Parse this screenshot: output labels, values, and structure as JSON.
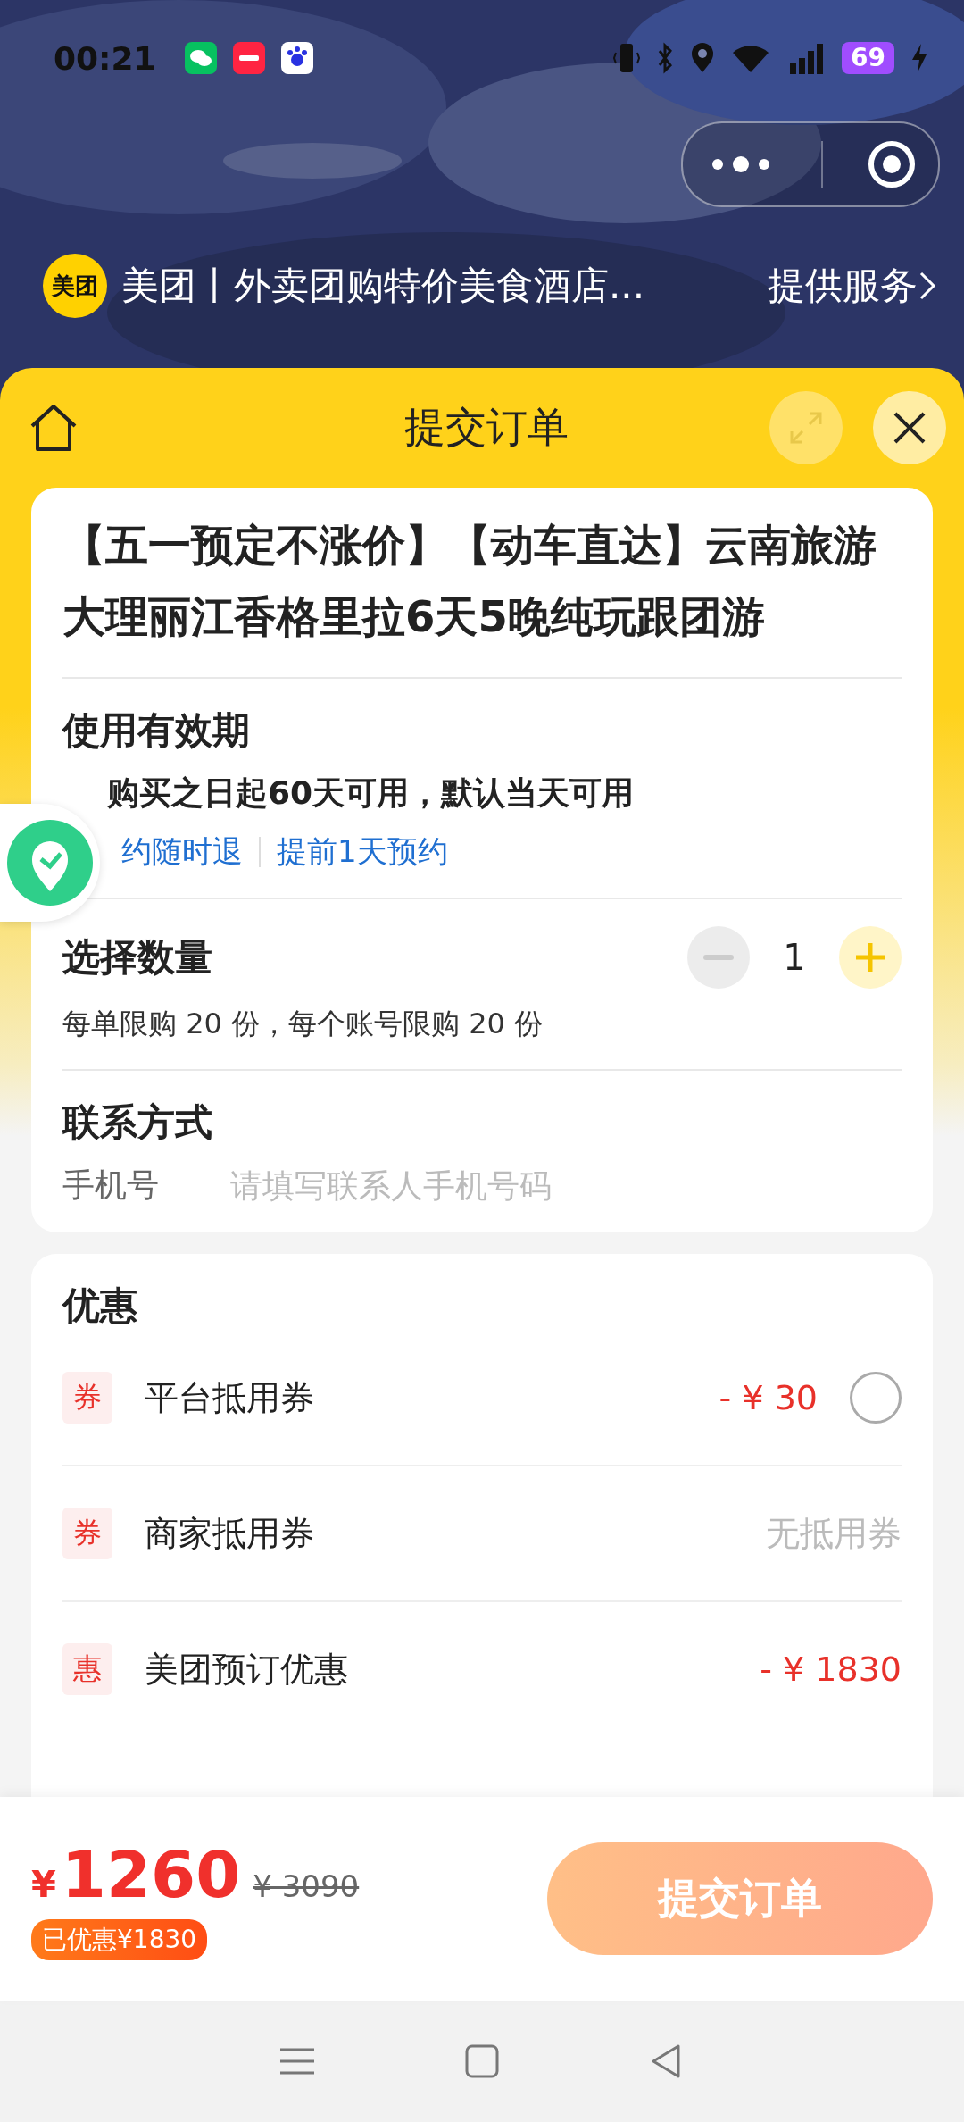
{
  "status_bar": {
    "time": "00:21",
    "battery": "69"
  },
  "mini_program": {
    "logo_text": "美团",
    "name": "美团丨外卖团购特价美食酒店...",
    "service_link": "提供服务"
  },
  "sheet": {
    "title": "提交订单",
    "expand_disabled": true
  },
  "product": {
    "title": "【五一预定不涨价】【动车直达】云南旅游大理丽江香格里拉6天5晚纯玩跟团游"
  },
  "validity": {
    "heading": "使用有效期",
    "text": "购买之日起60天可用，默认当天可用",
    "tags": [
      "约随时退",
      "提前1天预约"
    ]
  },
  "quantity": {
    "heading": "选择数量",
    "value": "1",
    "minus_disabled": true,
    "limit": "每单限购 20 份，每个账号限购 20 份"
  },
  "contact": {
    "heading": "联系方式",
    "label": "手机号",
    "placeholder": "请填写联系人手机号码"
  },
  "discounts": {
    "heading": "优惠",
    "rows": [
      {
        "badge": "券",
        "name": "平台抵用券",
        "value": "- ¥ 30",
        "kind": "radio",
        "checked": false
      },
      {
        "badge": "券",
        "name": "商家抵用券",
        "value": "无抵用券",
        "kind": "unavailable"
      },
      {
        "badge": "惠",
        "name": "美团预订优惠",
        "value": "- ¥ 1830",
        "kind": "amount"
      }
    ]
  },
  "footer": {
    "currency": "¥",
    "price": "1260",
    "original_price": "¥ 3090",
    "saved": "已优惠¥1830",
    "submit": "提交订单"
  }
}
